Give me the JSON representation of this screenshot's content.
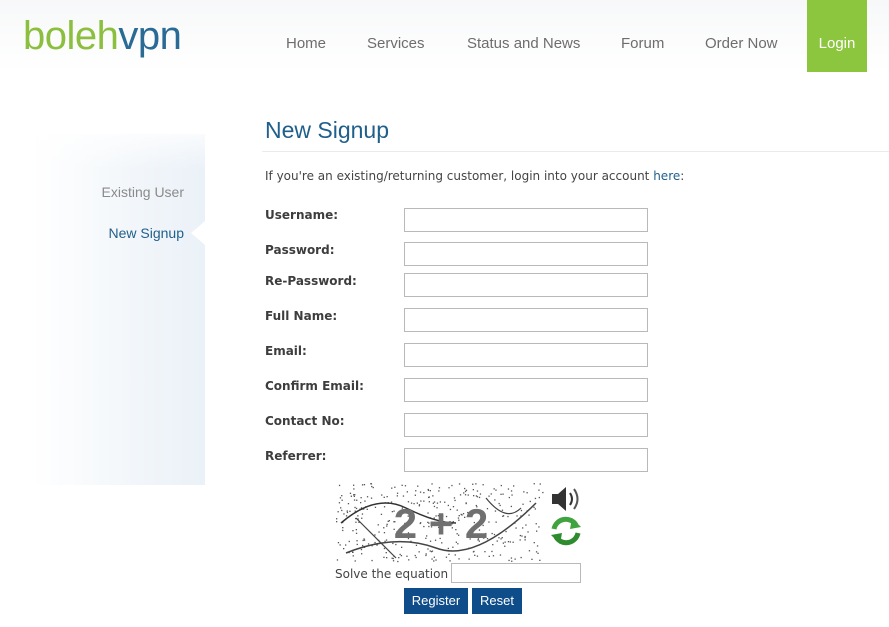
{
  "brand": {
    "logo_part1": "boleh",
    "logo_part2": "vpn"
  },
  "nav": {
    "items": [
      {
        "label": "Home"
      },
      {
        "label": "Services"
      },
      {
        "label": "Status and News"
      },
      {
        "label": "Forum"
      },
      {
        "label": "Order Now"
      }
    ],
    "login_label": "Login",
    "colors": {
      "login_bg": "#8cc63f",
      "nav_text": "#6d6d6d"
    }
  },
  "sidebar": {
    "items": [
      {
        "label": "Existing User",
        "active": false
      },
      {
        "label": "New Signup",
        "active": true
      }
    ]
  },
  "page": {
    "title": "New Signup",
    "intro_text": "If you're an existing/returning customer, login into your account ",
    "intro_link": "here",
    "intro_suffix": ":"
  },
  "form": {
    "fields": [
      {
        "label": "Username:",
        "value": ""
      },
      {
        "label": "Password:",
        "value": ""
      },
      {
        "label": "Re-Password:",
        "value": ""
      },
      {
        "label": "Full Name:",
        "value": ""
      },
      {
        "label": "Email:",
        "value": ""
      },
      {
        "label": "Confirm Email:",
        "value": ""
      },
      {
        "label": "Contact No:",
        "value": ""
      },
      {
        "label": "Referrer:",
        "value": ""
      }
    ],
    "captcha": {
      "equation": "2 + 2",
      "audio_icon": "speaker-icon",
      "refresh_icon": "refresh-icon"
    },
    "solve_label": "Solve the equation",
    "solve_value": "",
    "register_label": "Register",
    "reset_label": "Reset",
    "colors": {
      "button_bg": "#0f4c8a",
      "title": "#1f5f8b"
    }
  }
}
